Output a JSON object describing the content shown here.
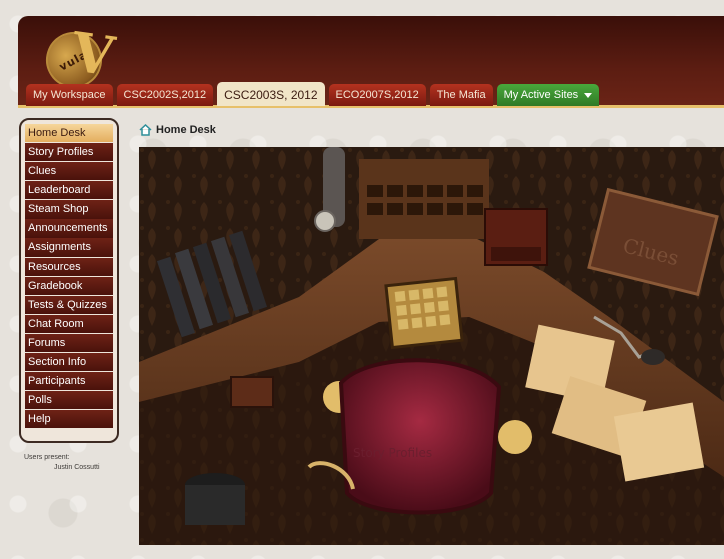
{
  "logo": {
    "text": "vula"
  },
  "tabs": [
    {
      "label": "My Workspace"
    },
    {
      "label": "CSC2002S,2012"
    },
    {
      "label": "CSC2003S, 2012"
    },
    {
      "label": "ECO2007S,2012"
    },
    {
      "label": "The Mafia"
    },
    {
      "label": "My Active Sites"
    }
  ],
  "sidebar": {
    "items": [
      {
        "label": "Home Desk"
      },
      {
        "label": "Story Profiles"
      },
      {
        "label": "Clues"
      },
      {
        "label": "Leaderboard"
      },
      {
        "label": "Steam Shop"
      },
      {
        "label": "Announcements"
      },
      {
        "label": "Assignments"
      },
      {
        "label": "Resources"
      },
      {
        "label": "Gradebook"
      },
      {
        "label": "Tests & Quizzes"
      },
      {
        "label": "Chat Room"
      },
      {
        "label": "Forums"
      },
      {
        "label": "Section Info"
      },
      {
        "label": "Participants"
      },
      {
        "label": "Polls"
      },
      {
        "label": "Help"
      }
    ],
    "users_label": "Users present:",
    "users": [
      "Justin Cossutti"
    ]
  },
  "breadcrumb": {
    "label": "Home Desk"
  },
  "scene": {
    "clues_sign": "Clues",
    "chair_text": "Story Profiles"
  },
  "colors": {
    "maroon": "#5c1d12",
    "gold": "#e7c06a",
    "active_green": "#49a83b"
  }
}
